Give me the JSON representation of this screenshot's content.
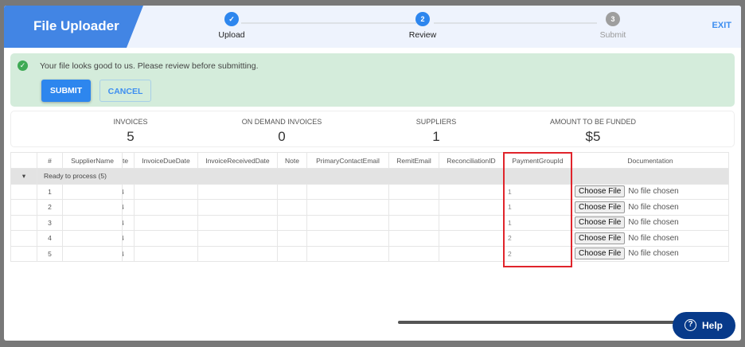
{
  "header": {
    "title": "File Uploader",
    "exit_label": "EXIT",
    "steps": [
      {
        "label": "Upload",
        "state": "done"
      },
      {
        "label": "Review",
        "number": "2",
        "state": "active"
      },
      {
        "label": "Submit",
        "number": "3",
        "state": "pending"
      }
    ]
  },
  "alert": {
    "message": "Your file looks good to us. Please review before submitting.",
    "submit_label": "SUBMIT",
    "cancel_label": "CANCEL"
  },
  "stats": [
    {
      "label": "INVOICES",
      "value": "5"
    },
    {
      "label": "ON DEMAND INVOICES",
      "value": "0"
    },
    {
      "label": "SUPPLIERS",
      "value": "1"
    },
    {
      "label": "AMOUNT TO BE FUNDED",
      "value": "$5"
    }
  ],
  "table": {
    "columns": [
      "#",
      "SupplierName",
      "te",
      "InvoiceDueDate",
      "InvoiceReceivedDate",
      "Note",
      "PrimaryContactEmail",
      "RemitEmail",
      "ReconciliationID",
      "PaymentGroupId",
      "Documentation"
    ],
    "group_label": "Ready to process (5)",
    "rows": [
      {
        "n": "1",
        "te": "4",
        "pg": "1"
      },
      {
        "n": "2",
        "te": "4",
        "pg": "1"
      },
      {
        "n": "3",
        "te": "4",
        "pg": "1"
      },
      {
        "n": "4",
        "te": "4",
        "pg": "2"
      },
      {
        "n": "5",
        "te": "4",
        "pg": "2"
      }
    ],
    "choose_file_label": "Choose File",
    "no_file_label": "No file chosen"
  },
  "help_label": "Help",
  "colors": {
    "brand": "#4285e4",
    "accent": "#2d86ee",
    "highlight": "#e0242b",
    "help": "#073a8a"
  }
}
